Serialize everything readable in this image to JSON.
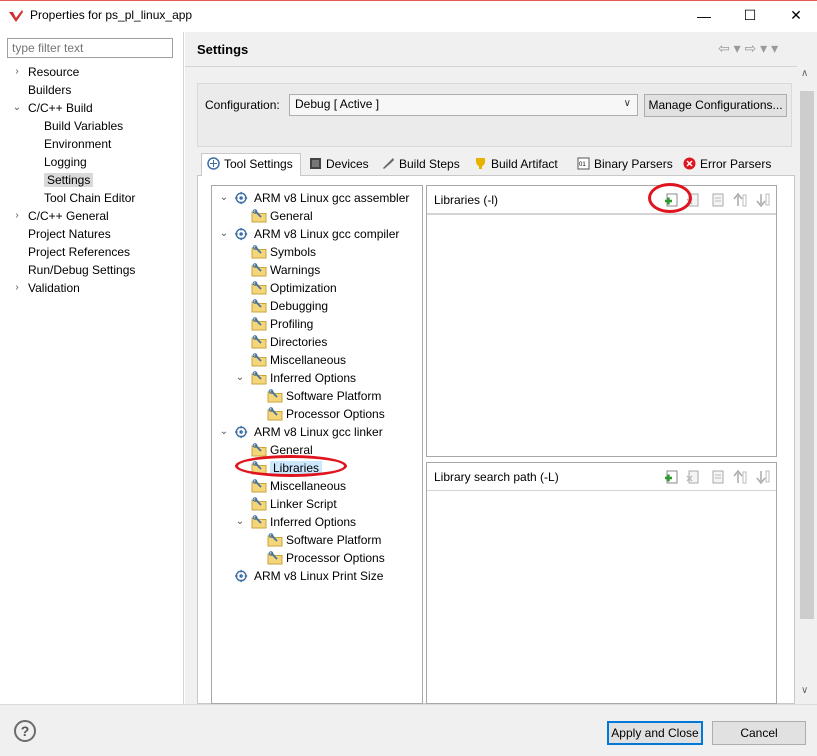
{
  "window": {
    "title": "Properties for ps_pl_linux_app",
    "minimize": "—",
    "maximize": "☐",
    "close": "✕"
  },
  "left": {
    "filter_placeholder": "type filter text",
    "items": [
      {
        "label": "Resource",
        "twisty": "›"
      },
      {
        "label": "Builders",
        "twisty": ""
      },
      {
        "label": "C/C++ Build",
        "twisty": "⌄"
      },
      {
        "label": "Build Variables",
        "twisty": ""
      },
      {
        "label": "Environment",
        "twisty": ""
      },
      {
        "label": "Logging",
        "twisty": ""
      },
      {
        "label": "Settings",
        "twisty": ""
      },
      {
        "label": "Tool Chain Editor",
        "twisty": ""
      },
      {
        "label": "C/C++ General",
        "twisty": "›"
      },
      {
        "label": "Project Natures",
        "twisty": ""
      },
      {
        "label": "Project References",
        "twisty": ""
      },
      {
        "label": "Run/Debug Settings",
        "twisty": ""
      },
      {
        "label": "Validation",
        "twisty": "›"
      }
    ]
  },
  "header": {
    "title": "Settings",
    "nav": "⇦ ▾ ⇨ ▾ ▾"
  },
  "config": {
    "label": "Configuration:",
    "value": "Debug  [ Active ]",
    "manage_label": "Manage Configurations..."
  },
  "tabs": [
    {
      "label": "Tool Settings"
    },
    {
      "label": "Devices"
    },
    {
      "label": "Build Steps"
    },
    {
      "label": "Build Artifact"
    },
    {
      "label": "Binary Parsers"
    },
    {
      "label": "Error Parsers"
    }
  ],
  "tool_tree": [
    {
      "label": "ARM v8 Linux gcc assembler",
      "type": "tool",
      "twisty": "⌄"
    },
    {
      "label": "General",
      "type": "option"
    },
    {
      "label": "ARM v8 Linux gcc compiler",
      "type": "tool",
      "twisty": "⌄"
    },
    {
      "label": "Symbols",
      "type": "option"
    },
    {
      "label": "Warnings",
      "type": "option"
    },
    {
      "label": "Optimization",
      "type": "option"
    },
    {
      "label": "Debugging",
      "type": "option"
    },
    {
      "label": "Profiling",
      "type": "option"
    },
    {
      "label": "Directories",
      "type": "option"
    },
    {
      "label": "Miscellaneous",
      "type": "option"
    },
    {
      "label": "Inferred Options",
      "type": "option",
      "twisty": "⌄"
    },
    {
      "label": "Software Platform",
      "type": "option"
    },
    {
      "label": "Processor Options",
      "type": "option"
    },
    {
      "label": "ARM v8 Linux gcc linker",
      "type": "tool",
      "twisty": "⌄"
    },
    {
      "label": "General",
      "type": "option"
    },
    {
      "label": "Libraries",
      "type": "option",
      "selected": true
    },
    {
      "label": "Miscellaneous",
      "type": "option"
    },
    {
      "label": "Linker Script",
      "type": "option"
    },
    {
      "label": "Inferred Options",
      "type": "option",
      "twisty": "⌄"
    },
    {
      "label": "Software Platform",
      "type": "option"
    },
    {
      "label": "Processor Options",
      "type": "option"
    },
    {
      "label": "ARM v8 Linux Print Size",
      "type": "tool"
    }
  ],
  "libraries": {
    "title": "Libraries (-l)"
  },
  "library_path": {
    "title": "Library search path (-L)"
  },
  "buttons": {
    "help": "?",
    "apply_close": "Apply and Close",
    "cancel": "Cancel"
  },
  "colors": {
    "annotation": "#e0141e",
    "accent": "#0078d7"
  }
}
